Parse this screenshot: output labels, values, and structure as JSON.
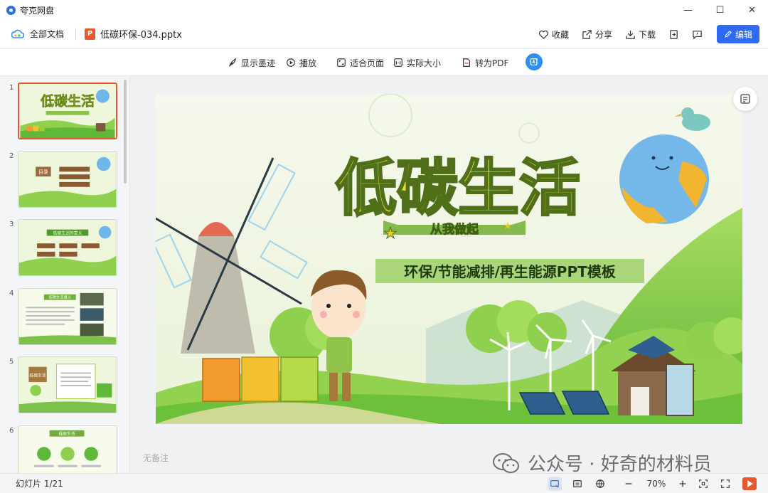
{
  "app": {
    "name": "夸克网盘"
  },
  "window": {
    "minimize": "—",
    "maximize": "☐",
    "close": "✕"
  },
  "topbar": {
    "breadcrumb": "全部文档",
    "file_badge": "P",
    "filename": "低碳环保-034.pptx",
    "actions": {
      "favorite": "收藏",
      "share": "分享",
      "download": "下载"
    },
    "edit": "编辑"
  },
  "toolbar": {
    "ink": "显示墨迹",
    "play": "播放",
    "fit": "适合页面",
    "actual": "实际大小",
    "pdf": "转为PDF"
  },
  "sidebar": {
    "thumbs": [
      {
        "num": "1",
        "title": "低碳生活"
      },
      {
        "num": "2",
        "title": "目录"
      },
      {
        "num": "3",
        "title": "低碳生活的意义"
      },
      {
        "num": "4",
        "title": "低碳生活意义"
      },
      {
        "num": "5",
        "title": "低碳生活"
      },
      {
        "num": "6",
        "title": "低碳生活"
      }
    ]
  },
  "slide": {
    "title": "低碳生活",
    "slogan": "从我做起",
    "subtitle": "环保/节能减排/再生能源PPT模板"
  },
  "notes": {
    "placeholder": "无备注"
  },
  "watermark": {
    "text": "公众号 · 好奇的材料员"
  },
  "status": {
    "slide_count": "幻灯片 1/21",
    "zoom": "70%"
  },
  "colors": {
    "accent": "#2f6bf2",
    "ppt_orange": "#e8572e",
    "slide_green": "#74c13d",
    "title_yellow": "#f2e52a"
  }
}
